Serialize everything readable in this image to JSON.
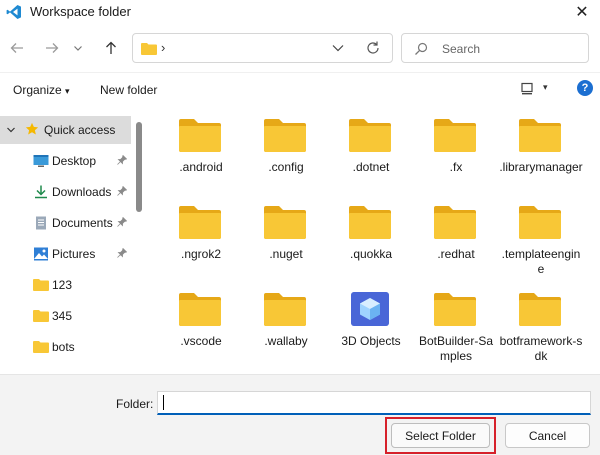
{
  "window": {
    "title": "Workspace folder",
    "close_glyph": "✕"
  },
  "navigation": {
    "address_chevron": "›",
    "search_placeholder": "Search"
  },
  "toolbar": {
    "organize_label": "Organize",
    "organize_caret": "▾",
    "new_folder_label": "New folder",
    "help_glyph": "?"
  },
  "sidebar": {
    "items": [
      {
        "label": "Quick access",
        "icon": "star-icon",
        "selected": true
      },
      {
        "label": "Desktop",
        "icon": "desktop-icon",
        "pinned": true
      },
      {
        "label": "Downloads",
        "icon": "download-icon",
        "pinned": true
      },
      {
        "label": "Documents",
        "icon": "documents-icon",
        "pinned": true
      },
      {
        "label": "Pictures",
        "icon": "pictures-icon",
        "pinned": true
      },
      {
        "label": "123",
        "icon": "folder-icon"
      },
      {
        "label": "345",
        "icon": "folder-icon"
      },
      {
        "label": "bots",
        "icon": "folder-icon"
      }
    ],
    "pin_glyph": "📌",
    "expand_caret": "⌄"
  },
  "folders": [
    {
      "name": ".android",
      "icon": "folder-icon"
    },
    {
      "name": ".config",
      "icon": "folder-icon"
    },
    {
      "name": ".dotnet",
      "icon": "folder-icon"
    },
    {
      "name": ".fx",
      "icon": "folder-icon"
    },
    {
      "name": ".librarymanager",
      "icon": "folder-icon"
    },
    {
      "name": ".ngrok2",
      "icon": "folder-icon"
    },
    {
      "name": ".nuget",
      "icon": "folder-icon"
    },
    {
      "name": ".quokka",
      "icon": "folder-icon"
    },
    {
      "name": ".redhat",
      "icon": "folder-icon"
    },
    {
      "name": ".templateengine",
      "icon": "folder-icon"
    },
    {
      "name": ".vscode",
      "icon": "folder-icon"
    },
    {
      "name": ".wallaby",
      "icon": "folder-icon"
    },
    {
      "name": "3D Objects",
      "icon": "3d-objects-icon"
    },
    {
      "name": "BotBuilder-Samples",
      "icon": "folder-icon"
    },
    {
      "name": "botframework-sdk",
      "icon": "folder-icon"
    }
  ],
  "footer": {
    "folder_label": "Folder:",
    "folder_value": "",
    "select_button": "Select Folder",
    "cancel_button": "Cancel"
  },
  "colors": {
    "accent": "#005fb8",
    "folder_yellow": "#f8c736",
    "highlight_red": "#d6202a",
    "selected_bg": "#dcdcdc"
  }
}
